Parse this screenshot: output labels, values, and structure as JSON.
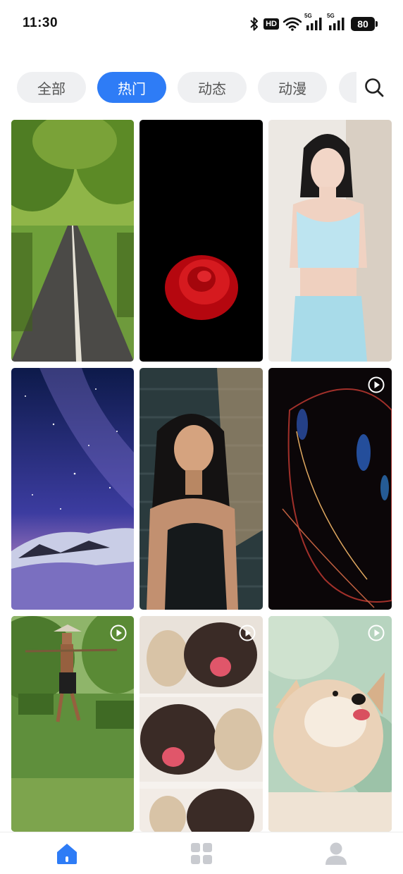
{
  "status_bar": {
    "time": "11:30",
    "hd_label": "HD",
    "network_label_1": "5G",
    "network_label_2": "5G",
    "battery_level": "80",
    "icons": [
      "bluetooth-icon",
      "wifi-icon",
      "signal-icon",
      "battery-icon"
    ]
  },
  "tabs": [
    {
      "label": "全部",
      "active": false
    },
    {
      "label": "热门",
      "active": true
    },
    {
      "label": "动态",
      "active": false
    },
    {
      "label": "动漫",
      "active": false
    }
  ],
  "search": {
    "icon": "search-icon"
  },
  "grid": {
    "items": [
      {
        "subject": "tree-lined road",
        "video": false
      },
      {
        "subject": "red rose on black",
        "video": false
      },
      {
        "subject": "woman portrait",
        "video": false
      },
      {
        "subject": "starry sky over snowy mountain",
        "video": false
      },
      {
        "subject": "woman in shadow portrait",
        "video": false
      },
      {
        "subject": "abstract glass curve",
        "video": true
      },
      {
        "subject": "farmer carrying rice seedlings",
        "video": true
      },
      {
        "subject": "pug dogs",
        "video": true
      },
      {
        "subject": "corgi puppy",
        "video": true
      }
    ]
  },
  "bottom_nav": [
    {
      "icon": "home-icon",
      "active": true
    },
    {
      "icon": "category-grid-icon",
      "active": false
    },
    {
      "icon": "profile-icon",
      "active": false
    }
  ],
  "colors": {
    "accent": "#2e7cf6",
    "tab_bg": "#eff0f2",
    "inactive_icon": "#c9cbd0"
  }
}
